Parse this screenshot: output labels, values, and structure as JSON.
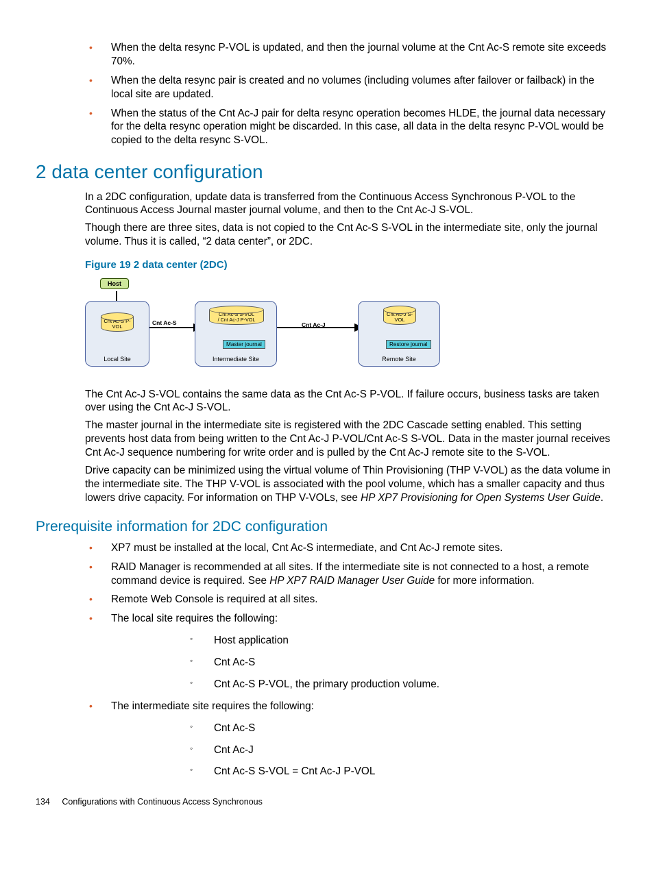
{
  "intro_bullets": [
    "When the delta resync P-VOL is updated, and then the journal volume at the Cnt Ac-S remote site exceeds 70%.",
    "When the delta resync pair is created and no volumes (including volumes after failover or failback) in the local site are updated.",
    "When the status of the Cnt Ac-J pair for delta resync operation becomes HLDE, the journal data necessary for the delta resync operation might be discarded. In this case, all data in the delta resync P-VOL would be copied to the delta resync S-VOL."
  ],
  "h1": "2 data center configuration",
  "p1": "In a 2DC configuration, update data is transferred from the Continuous Access Synchronous P-VOL to the Continuous Access Journal master journal volume, and then to the Cnt Ac-J S-VOL.",
  "p2": "Though there are three sites, data is not copied to the Cnt Ac-S S-VOL in the intermediate site, only the journal volume. Thus it is called, “2 data center”, or 2DC.",
  "figure_title": "Figure 19 2 data center (2DC)",
  "diagram": {
    "host": "Host",
    "local": {
      "label": "Local Site",
      "vol": "Cnt Ac-S P-VOL"
    },
    "inter": {
      "label": "Intermediate Site",
      "vol_l1": "Cnt Ac-S S-VOL",
      "vol_l2": "/ Cnt Ac-J P-VOL",
      "journal": "Master journal"
    },
    "remote": {
      "label": "Remote Site",
      "vol": "Cnt Ac-J S-VOL",
      "journal": "Restore journal"
    },
    "link1": "Cnt Ac-S",
    "link2": "Cnt Ac-J"
  },
  "p3": "The Cnt Ac-J S-VOL contains the same data as the Cnt Ac-S P-VOL. If failure occurs, business tasks are taken over using the Cnt Ac-J S-VOL.",
  "p4": "The master journal in the intermediate site is registered with the 2DC Cascade setting enabled. This setting prevents host data from being written to the Cnt Ac-J P-VOL/Cnt Ac-S S-VOL. Data in the master journal receives Cnt Ac-J sequence numbering for write order and is pulled by the Cnt Ac-J remote site to the S-VOL.",
  "p5a": "Drive capacity can be minimized using the virtual volume of Thin Provisioning (THP V-VOL) as the data volume in the intermediate site. The THP V-VOL is associated with the pool volume, which has a smaller capacity and thus lowers drive capacity. For information on THP V-VOLs, see ",
  "p5b": "HP XP7 Provisioning for Open Systems User Guide",
  "p5c": ".",
  "h2": "Prerequisite information for 2DC configuration",
  "prereq": {
    "b1": "XP7 must be installed at the local, Cnt Ac-S intermediate, and Cnt Ac-J remote sites.",
    "b2a": "RAID Manager is recommended at all sites. If the intermediate site is not connected to a host, a remote command device is required. See ",
    "b2b": "HP XP7 RAID Manager User Guide",
    "b2c": " for more information.",
    "b3": "Remote Web Console is required at all sites.",
    "b4": "The local site requires the following:",
    "b4_sub": [
      "Host application",
      "Cnt Ac-S",
      "Cnt Ac-S P-VOL, the primary production volume."
    ],
    "b5": "The intermediate site requires the following:",
    "b5_sub": [
      "Cnt Ac-S",
      "Cnt Ac-J",
      "Cnt Ac-S S-VOL = Cnt Ac-J P-VOL"
    ]
  },
  "footer": {
    "page": "134",
    "section": "Configurations with Continuous Access Synchronous"
  }
}
